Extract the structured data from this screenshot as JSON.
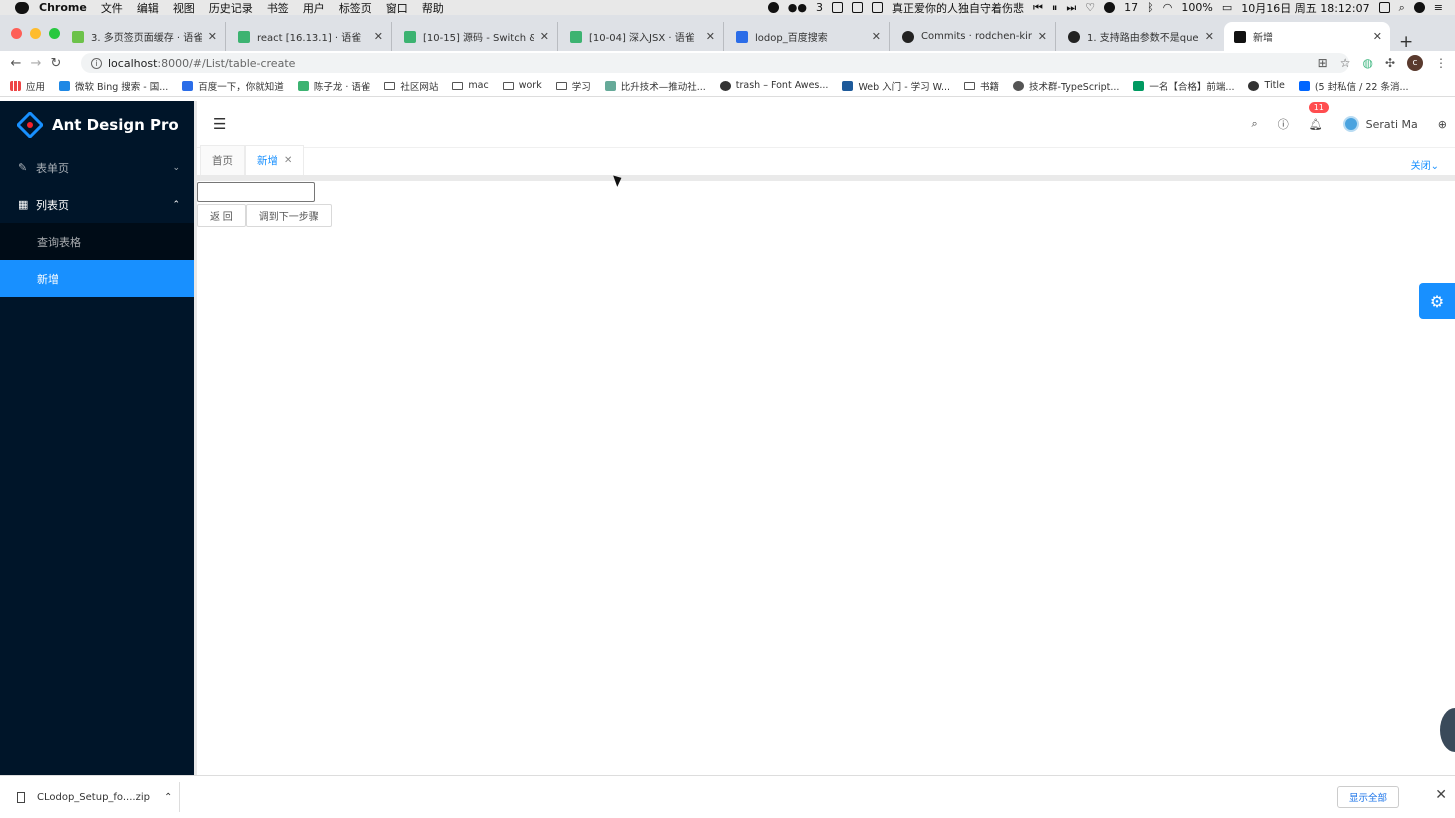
{
  "macmenu": {
    "items": [
      "Chrome",
      "文件",
      "编辑",
      "视图",
      "历史记录",
      "书签",
      "用户",
      "标签页",
      "窗口",
      "帮助"
    ],
    "wechat_count": "3",
    "song": "真正爱你的人独自守着伤悲",
    "notif_count": "17",
    "battery": "100%",
    "datetime": "10月16日 周五  18:12:07"
  },
  "tabs": [
    {
      "title": "3. 多页签页面缓存 · 语雀",
      "color": "#6cc24a"
    },
    {
      "title": "react [16.13.1] · 语雀",
      "color": "#3cb371"
    },
    {
      "title": "[10-15] 源码 - Switch & Rou",
      "color": "#3cb371"
    },
    {
      "title": "[10-04] 深入JSX · 语雀",
      "color": "#3cb371"
    },
    {
      "title": "lodop_百度搜索",
      "color": "#2b6de8"
    },
    {
      "title": "Commits · rodchen-king/ar",
      "color": "#222222"
    },
    {
      "title": "1. 支持路由参数不是query是",
      "color": "#222222"
    },
    {
      "title": "新增",
      "color": "#111111"
    }
  ],
  "address": {
    "host": "localhost",
    "rest": ":8000/#/List/table-create"
  },
  "bookmarks": [
    "应用",
    "微软 Bing 搜索 - 国...",
    "百度一下，你就知道",
    "陈子龙 · 语雀",
    "社区网站",
    "mac",
    "work",
    "学习",
    "比升技术—推动社...",
    "trash – Font Awes...",
    "Web 入门 - 学习 W...",
    "书籍",
    "技术群-TypeScript...",
    "一名【合格】前端...",
    "Title",
    "(5 封私信 / 22 条消..."
  ],
  "app": {
    "title": "Ant Design Pro"
  },
  "sidebar": {
    "items": [
      {
        "label": "表单页",
        "icon": "form-icon",
        "arrow": "⌄"
      },
      {
        "label": "列表页",
        "icon": "table-icon",
        "arrow": "⌃"
      }
    ],
    "sub": [
      {
        "label": "查询表格"
      },
      {
        "label": "新增"
      }
    ]
  },
  "header": {
    "notice_count": "11",
    "user": "Serati Ma"
  },
  "pagetabs": [
    {
      "label": "首页"
    },
    {
      "label": "新增"
    }
  ],
  "close_all": "关闭",
  "form": {
    "input_value": "",
    "back_label": "返 回",
    "next_label": "调到下一步骤"
  },
  "download": {
    "file": "CLodop_Setup_fo....zip",
    "show_all": "显示全部"
  },
  "colors": {
    "primary": "#1890ff",
    "sider": "#001529",
    "badge": "#ff4d4f"
  }
}
